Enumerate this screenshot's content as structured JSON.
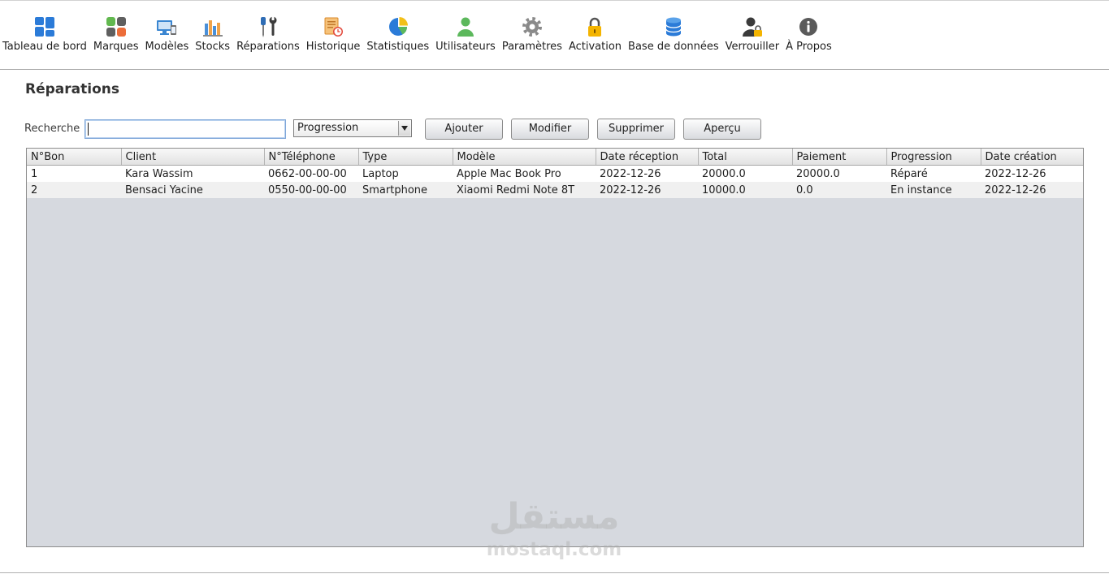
{
  "toolbar": {
    "items": [
      {
        "label": "Tableau de bord",
        "icon": "dashboard-icon"
      },
      {
        "label": "Marques",
        "icon": "brands-icon"
      },
      {
        "label": "Modèles",
        "icon": "models-icon"
      },
      {
        "label": "Stocks",
        "icon": "stocks-icon"
      },
      {
        "label": "Réparations",
        "icon": "repairs-icon"
      },
      {
        "label": "Historique",
        "icon": "history-icon"
      },
      {
        "label": "Statistiques",
        "icon": "statistics-icon"
      },
      {
        "label": "Utilisateurs",
        "icon": "users-icon"
      },
      {
        "label": "Paramètres",
        "icon": "settings-icon"
      },
      {
        "label": "Activation",
        "icon": "activation-lock-icon"
      },
      {
        "label": "Base de données",
        "icon": "database-icon"
      },
      {
        "label": "Verrouiller",
        "icon": "lock-user-icon"
      },
      {
        "label": "À Propos",
        "icon": "info-icon"
      }
    ]
  },
  "page": {
    "title": "Réparations"
  },
  "search": {
    "label": "Recherche",
    "value": ""
  },
  "filter": {
    "selected": "Progression"
  },
  "actions": {
    "add": "Ajouter",
    "edit": "Modifier",
    "delete": "Supprimer",
    "preview": "Aperçu"
  },
  "table": {
    "columns": [
      "N°Bon",
      "Client",
      "N°Téléphone",
      "Type",
      "Modèle",
      "Date réception",
      "Total",
      "Paiement",
      "Progression",
      "Date création"
    ],
    "rows": [
      [
        "1",
        "Kara Wassim",
        "0662-00-00-00",
        "Laptop",
        "Apple Mac Book Pro",
        "2022-12-26",
        "20000.0",
        "20000.0",
        "Réparé",
        "2022-12-26"
      ],
      [
        "2",
        "Bensaci Yacine",
        "0550-00-00-00",
        "Smartphone",
        "Xiaomi Redmi Note 8T",
        "2022-12-26",
        "10000.0",
        "0.0",
        "En instance",
        "2022-12-26"
      ]
    ]
  },
  "watermark": {
    "arabic": "مستقل",
    "latin": "mostaql.com"
  },
  "colors": {
    "accent": "#2b7bd8",
    "table_viewport": "#d6d9df",
    "input_focus": "#7ea6d8"
  }
}
